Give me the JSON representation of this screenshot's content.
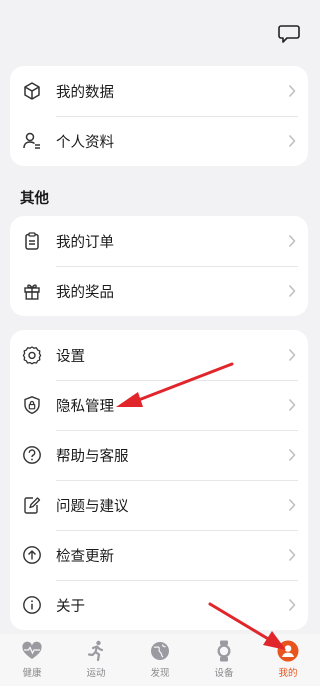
{
  "header": {
    "icon": "message-icon"
  },
  "cards": [
    {
      "items": [
        {
          "icon": "cube-icon",
          "label": "我的数据"
        },
        {
          "icon": "profile-icon",
          "label": "个人资料"
        }
      ]
    },
    {
      "items": [
        {
          "icon": "clipboard-icon",
          "label": "我的订单"
        },
        {
          "icon": "gift-icon",
          "label": "我的奖品"
        }
      ]
    },
    {
      "items": [
        {
          "icon": "gear-icon",
          "label": "设置"
        },
        {
          "icon": "shield-lock-icon",
          "label": "隐私管理"
        },
        {
          "icon": "help-icon",
          "label": "帮助与客服"
        },
        {
          "icon": "edit-note-icon",
          "label": "问题与建议"
        },
        {
          "icon": "upload-arrow-icon",
          "label": "检查更新"
        },
        {
          "icon": "info-icon",
          "label": "关于"
        }
      ]
    }
  ],
  "section_title": "其他",
  "tabbar": {
    "tabs": [
      {
        "icon": "heart-pulse-icon",
        "label": "健康"
      },
      {
        "icon": "running-icon",
        "label": "运动"
      },
      {
        "icon": "globe-icon",
        "label": "发现"
      },
      {
        "icon": "watch-icon",
        "label": "设备"
      },
      {
        "icon": "user-icon",
        "label": "我的"
      }
    ],
    "active_index": 4,
    "accent_color": "#e8541e"
  },
  "annotation_color": "#e0262b"
}
